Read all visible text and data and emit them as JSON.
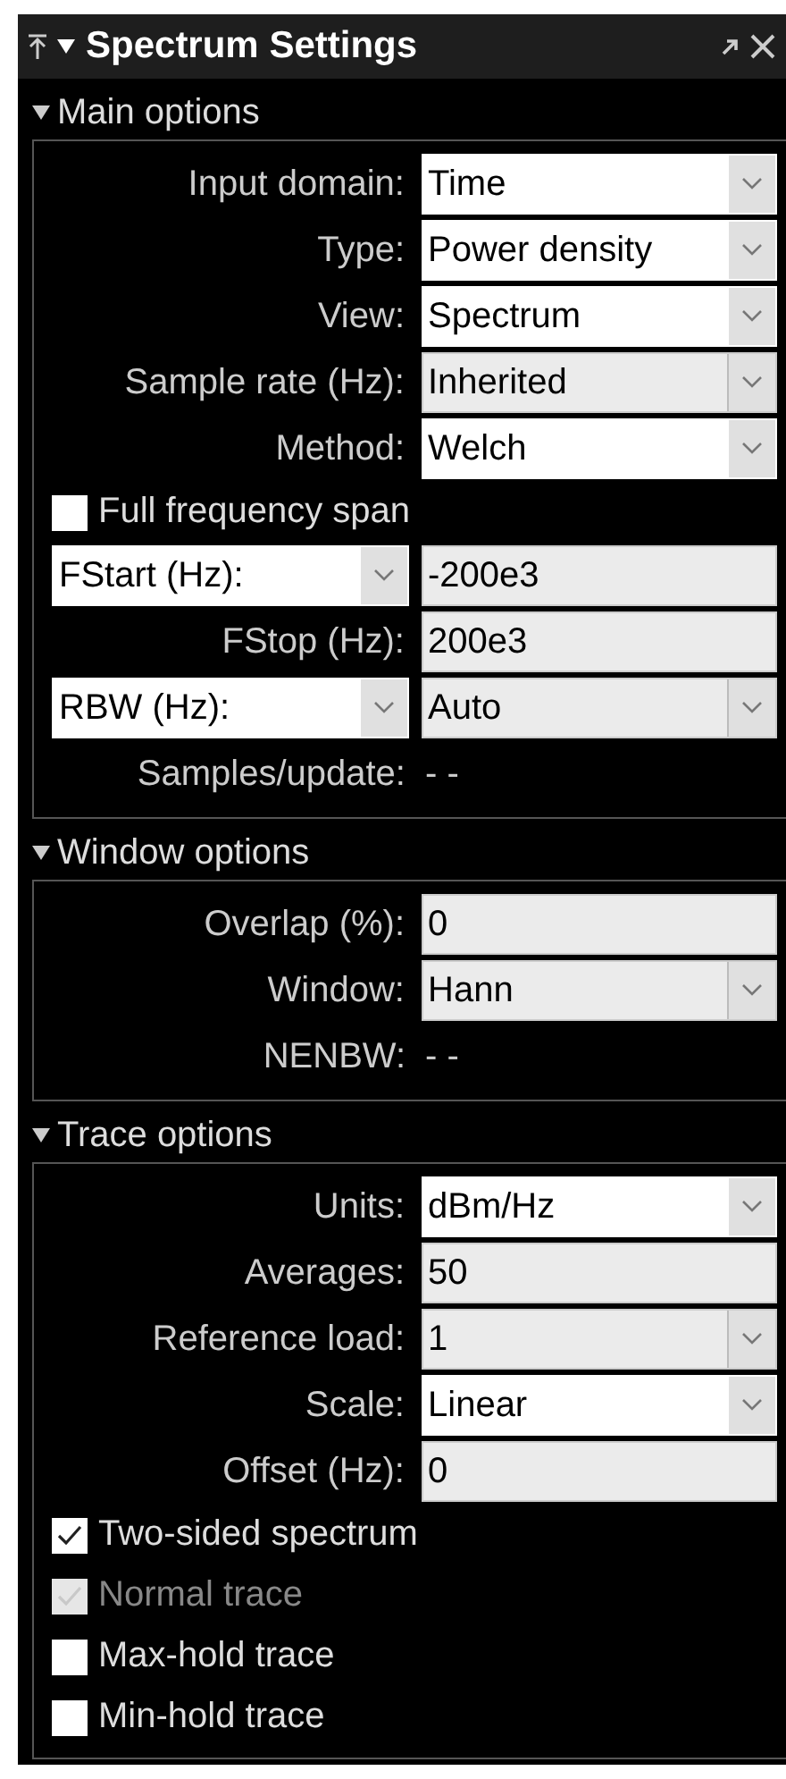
{
  "window": {
    "title": "Spectrum Settings"
  },
  "sections": [
    {
      "title": "Main options",
      "expanded": true,
      "rows": [
        {
          "kind": "row",
          "label": {
            "kind": "text",
            "text": "Input domain:"
          },
          "control": {
            "kind": "select",
            "value": "Time"
          }
        },
        {
          "kind": "row",
          "label": {
            "kind": "text",
            "text": "Type:"
          },
          "control": {
            "kind": "select",
            "value": "Power density"
          }
        },
        {
          "kind": "row",
          "label": {
            "kind": "text",
            "text": "View:"
          },
          "control": {
            "kind": "select",
            "value": "Spectrum"
          }
        },
        {
          "kind": "row",
          "label": {
            "kind": "text",
            "text": "Sample rate (Hz):"
          },
          "control": {
            "kind": "combo",
            "value": "Inherited"
          }
        },
        {
          "kind": "row",
          "label": {
            "kind": "text",
            "text": "Method:"
          },
          "control": {
            "kind": "select",
            "value": "Welch"
          }
        },
        {
          "kind": "checkbox",
          "label": "Full frequency span",
          "checked": false,
          "disabled": false
        },
        {
          "kind": "row",
          "label": {
            "kind": "select",
            "text": "FStart (Hz):"
          },
          "control": {
            "kind": "field",
            "value": "-200e3"
          }
        },
        {
          "kind": "row",
          "label": {
            "kind": "text",
            "text": "FStop (Hz):"
          },
          "control": {
            "kind": "field",
            "value": "200e3"
          }
        },
        {
          "kind": "row",
          "label": {
            "kind": "select",
            "text": "RBW (Hz):"
          },
          "control": {
            "kind": "combo",
            "value": "Auto"
          }
        },
        {
          "kind": "row",
          "label": {
            "kind": "text",
            "text": "Samples/update:"
          },
          "control": {
            "kind": "readout",
            "value": "- -"
          }
        }
      ]
    },
    {
      "title": "Window options",
      "expanded": true,
      "rows": [
        {
          "kind": "row",
          "label": {
            "kind": "text",
            "text": "Overlap (%):"
          },
          "control": {
            "kind": "field",
            "value": "0"
          }
        },
        {
          "kind": "row",
          "label": {
            "kind": "text",
            "text": "Window:"
          },
          "control": {
            "kind": "combo",
            "value": "Hann"
          }
        },
        {
          "kind": "row",
          "label": {
            "kind": "text",
            "text": "NENBW:"
          },
          "control": {
            "kind": "readout",
            "value": "- -"
          }
        }
      ]
    },
    {
      "title": "Trace options",
      "expanded": true,
      "rows": [
        {
          "kind": "row",
          "label": {
            "kind": "text",
            "text": "Units:"
          },
          "control": {
            "kind": "select",
            "value": "dBm/Hz"
          }
        },
        {
          "kind": "row",
          "label": {
            "kind": "text",
            "text": "Averages:"
          },
          "control": {
            "kind": "field",
            "value": "50"
          }
        },
        {
          "kind": "row",
          "label": {
            "kind": "text",
            "text": "Reference load:"
          },
          "control": {
            "kind": "combo",
            "value": "1"
          }
        },
        {
          "kind": "row",
          "label": {
            "kind": "text",
            "text": "Scale:"
          },
          "control": {
            "kind": "select",
            "value": "Linear"
          }
        },
        {
          "kind": "row",
          "label": {
            "kind": "text",
            "text": "Offset (Hz):"
          },
          "control": {
            "kind": "field",
            "value": "0"
          }
        },
        {
          "kind": "checkbox",
          "label": "Two-sided spectrum",
          "checked": true,
          "disabled": false
        },
        {
          "kind": "checkbox",
          "label": "Normal trace",
          "checked": true,
          "disabled": true
        },
        {
          "kind": "checkbox",
          "label": "Max-hold trace",
          "checked": false,
          "disabled": false
        },
        {
          "kind": "checkbox",
          "label": "Min-hold trace",
          "checked": false,
          "disabled": false
        }
      ]
    }
  ]
}
